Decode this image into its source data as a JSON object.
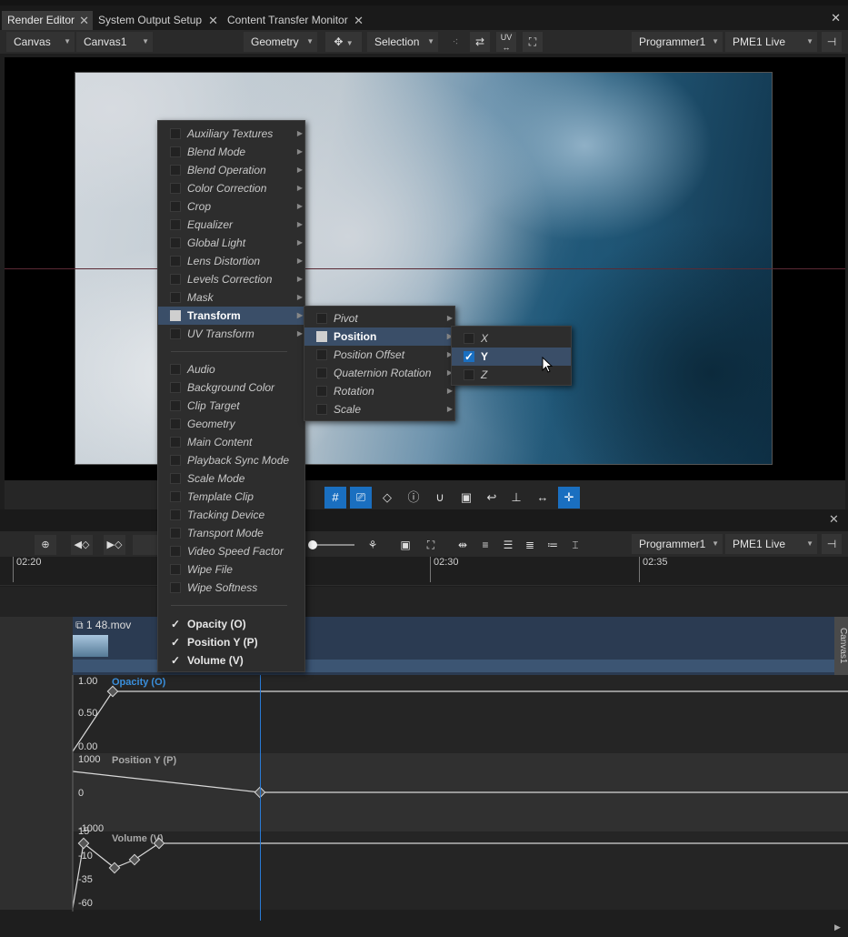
{
  "tabs": [
    {
      "label": "Render Editor",
      "active": true
    },
    {
      "label": "System Output Setup",
      "active": false
    },
    {
      "label": "Content Transfer Monitor",
      "active": false
    }
  ],
  "toolbar": {
    "canvas_type": "Canvas",
    "canvas_name": "Canvas1",
    "geometry": "Geometry",
    "selection": "Selection",
    "uv_label": "UV",
    "programmer": "Programmer1",
    "live": "PME1 Live"
  },
  "viewport_icons": [
    "grid-icon",
    "camera-icon",
    "perspective-icon",
    "info-icon",
    "magnet-icon",
    "snapshot-icon",
    "undo-icon",
    "align-vertical-icon",
    "align-horizontal-icon",
    "crosshair-icon"
  ],
  "timeline": {
    "programmer": "Programmer1",
    "live": "PME1 Live",
    "ruler": [
      "02:20",
      "02:30",
      "02:35"
    ],
    "clip_name": "1 48.mov",
    "canvas_tag": "Canvas1",
    "lanes": [
      {
        "name": "Opacity (O)",
        "labels": [
          "1.00",
          "0.50",
          "0.00"
        ]
      },
      {
        "name": "Position Y (P)",
        "labels": [
          "1000",
          "0",
          "-1000"
        ]
      },
      {
        "name": "Volume (V)",
        "labels": [
          "15",
          "-10",
          "-35",
          "-60"
        ]
      }
    ]
  },
  "menu_main": {
    "group1": [
      "Auxiliary Textures",
      "Blend Mode",
      "Blend Operation",
      "Color Correction",
      "Crop",
      "Equalizer",
      "Global Light",
      "Lens Distortion",
      "Levels Correction",
      "Mask",
      "Transform",
      "UV Transform"
    ],
    "group2": [
      "Audio",
      "Background Color",
      "Clip Target",
      "Geometry",
      "Main Content",
      "Playback Sync Mode",
      "Scale Mode",
      "Template Clip",
      "Tracking Device",
      "Transport Mode",
      "Video Speed Factor",
      "Wipe File",
      "Wipe Softness"
    ],
    "group3": [
      "Opacity (O)",
      "Position Y (P)",
      "Volume (V)"
    ]
  },
  "menu_transform": [
    "Pivot",
    "Position",
    "Position Offset",
    "Quaternion Rotation",
    "Rotation",
    "Scale"
  ],
  "menu_position": [
    "X",
    "Y",
    "Z"
  ],
  "check_mark": "✓",
  "colors": {
    "accent": "#1a6fc0",
    "highlight": "#3a4e68",
    "playhead": "#2a7bd6"
  }
}
